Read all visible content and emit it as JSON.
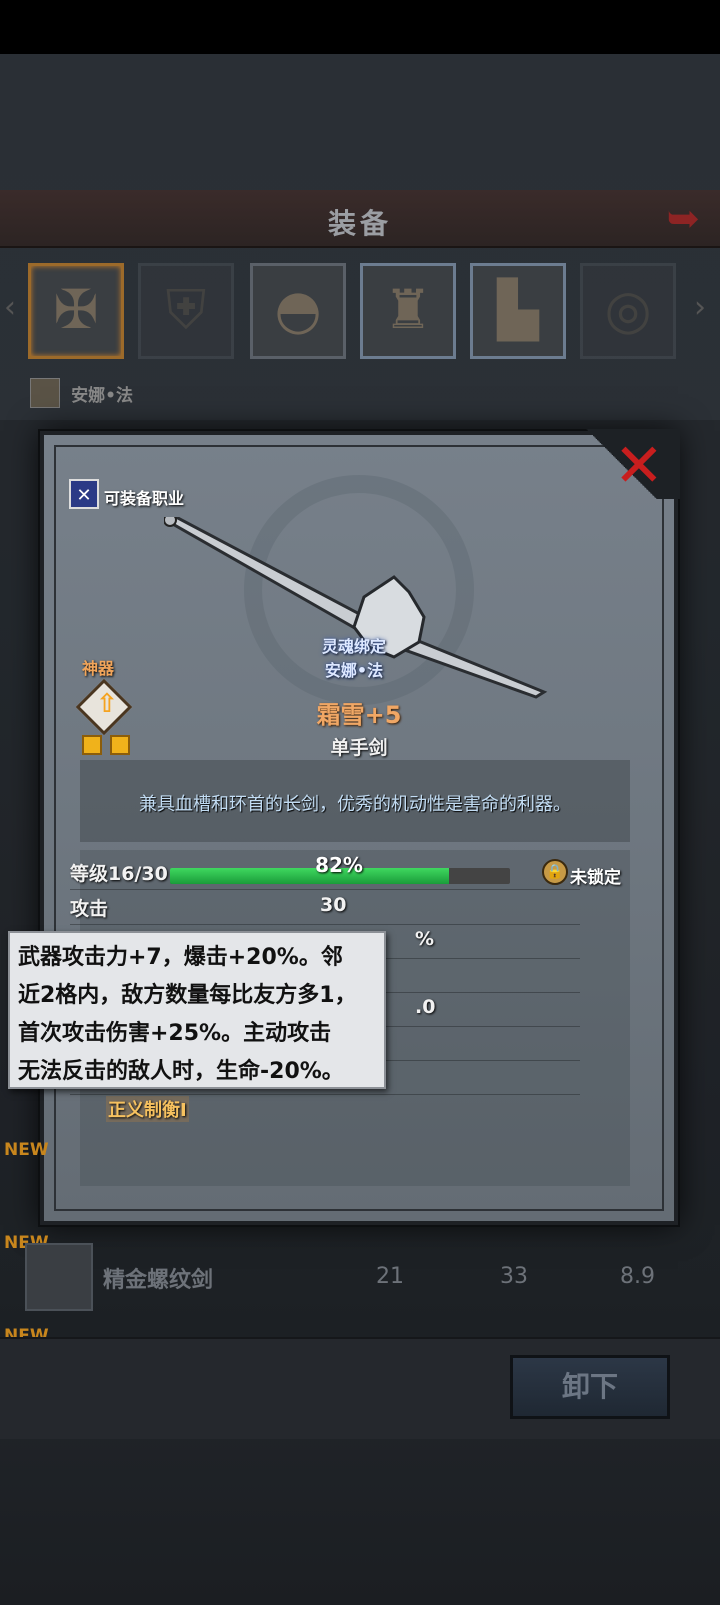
{
  "screen": {
    "title": "装备",
    "back_icon": "back-arrow-icon"
  },
  "character": {
    "name": "安娜•法"
  },
  "equipment_slots": [
    {
      "name": "weapon",
      "selected": true,
      "icon": "sword-icon",
      "glyph": "✠"
    },
    {
      "name": "shield",
      "selected": false,
      "icon": "shield-icon",
      "glyph": "⛨"
    },
    {
      "name": "hood",
      "selected": false,
      "icon": "hood-icon",
      "glyph": "◓"
    },
    {
      "name": "armor",
      "selected": false,
      "icon": "armor-icon",
      "glyph": "♜"
    },
    {
      "name": "boots",
      "selected": false,
      "icon": "boots-icon",
      "glyph": "▙"
    },
    {
      "name": "ring",
      "selected": false,
      "icon": "ring-icon",
      "glyph": "◎"
    }
  ],
  "detail": {
    "class_label": "可装备职业",
    "soulbound_label": "灵魂绑定",
    "soulbound_owner": "安娜•法",
    "relic_label": "神器",
    "gem_count": 2,
    "item_name": "霜雪+5",
    "item_type": "单手剑",
    "description": "兼具血槽和环首的长剑，优秀的机动性是害命的利器。",
    "level_label": "等级16/30",
    "level_progress_percent": 82,
    "level_progress_text": "82%",
    "lock_label": "未锁定",
    "stats": [
      {
        "label": "攻击",
        "value": "30"
      }
    ],
    "partial_values": [
      "%",
      ".0"
    ],
    "skill_name": "正义制衡I",
    "close_icon": "close-x-icon"
  },
  "tooltip": {
    "lines": [
      "武器攻击力+7，爆击+20%。邻",
      "近2格内，敌方数量每比友方多1，",
      "首次攻击伤害+25%。主动攻击",
      "无法反击的敌人时，生命-20%。"
    ]
  },
  "item_list": [
    {
      "new_tag": "NEW",
      "name": "精金螺纹剑",
      "values": [
        "21",
        "33",
        "8.9"
      ]
    }
  ],
  "new_tags": [
    "NEW",
    "NEW"
  ],
  "actions": {
    "unequip_label": "卸下"
  },
  "colors": {
    "accent_green": "#3fd85f",
    "close_red": "#c81e1e",
    "name_orange": "#f0a765",
    "relic_orange": "#f2a55a"
  }
}
